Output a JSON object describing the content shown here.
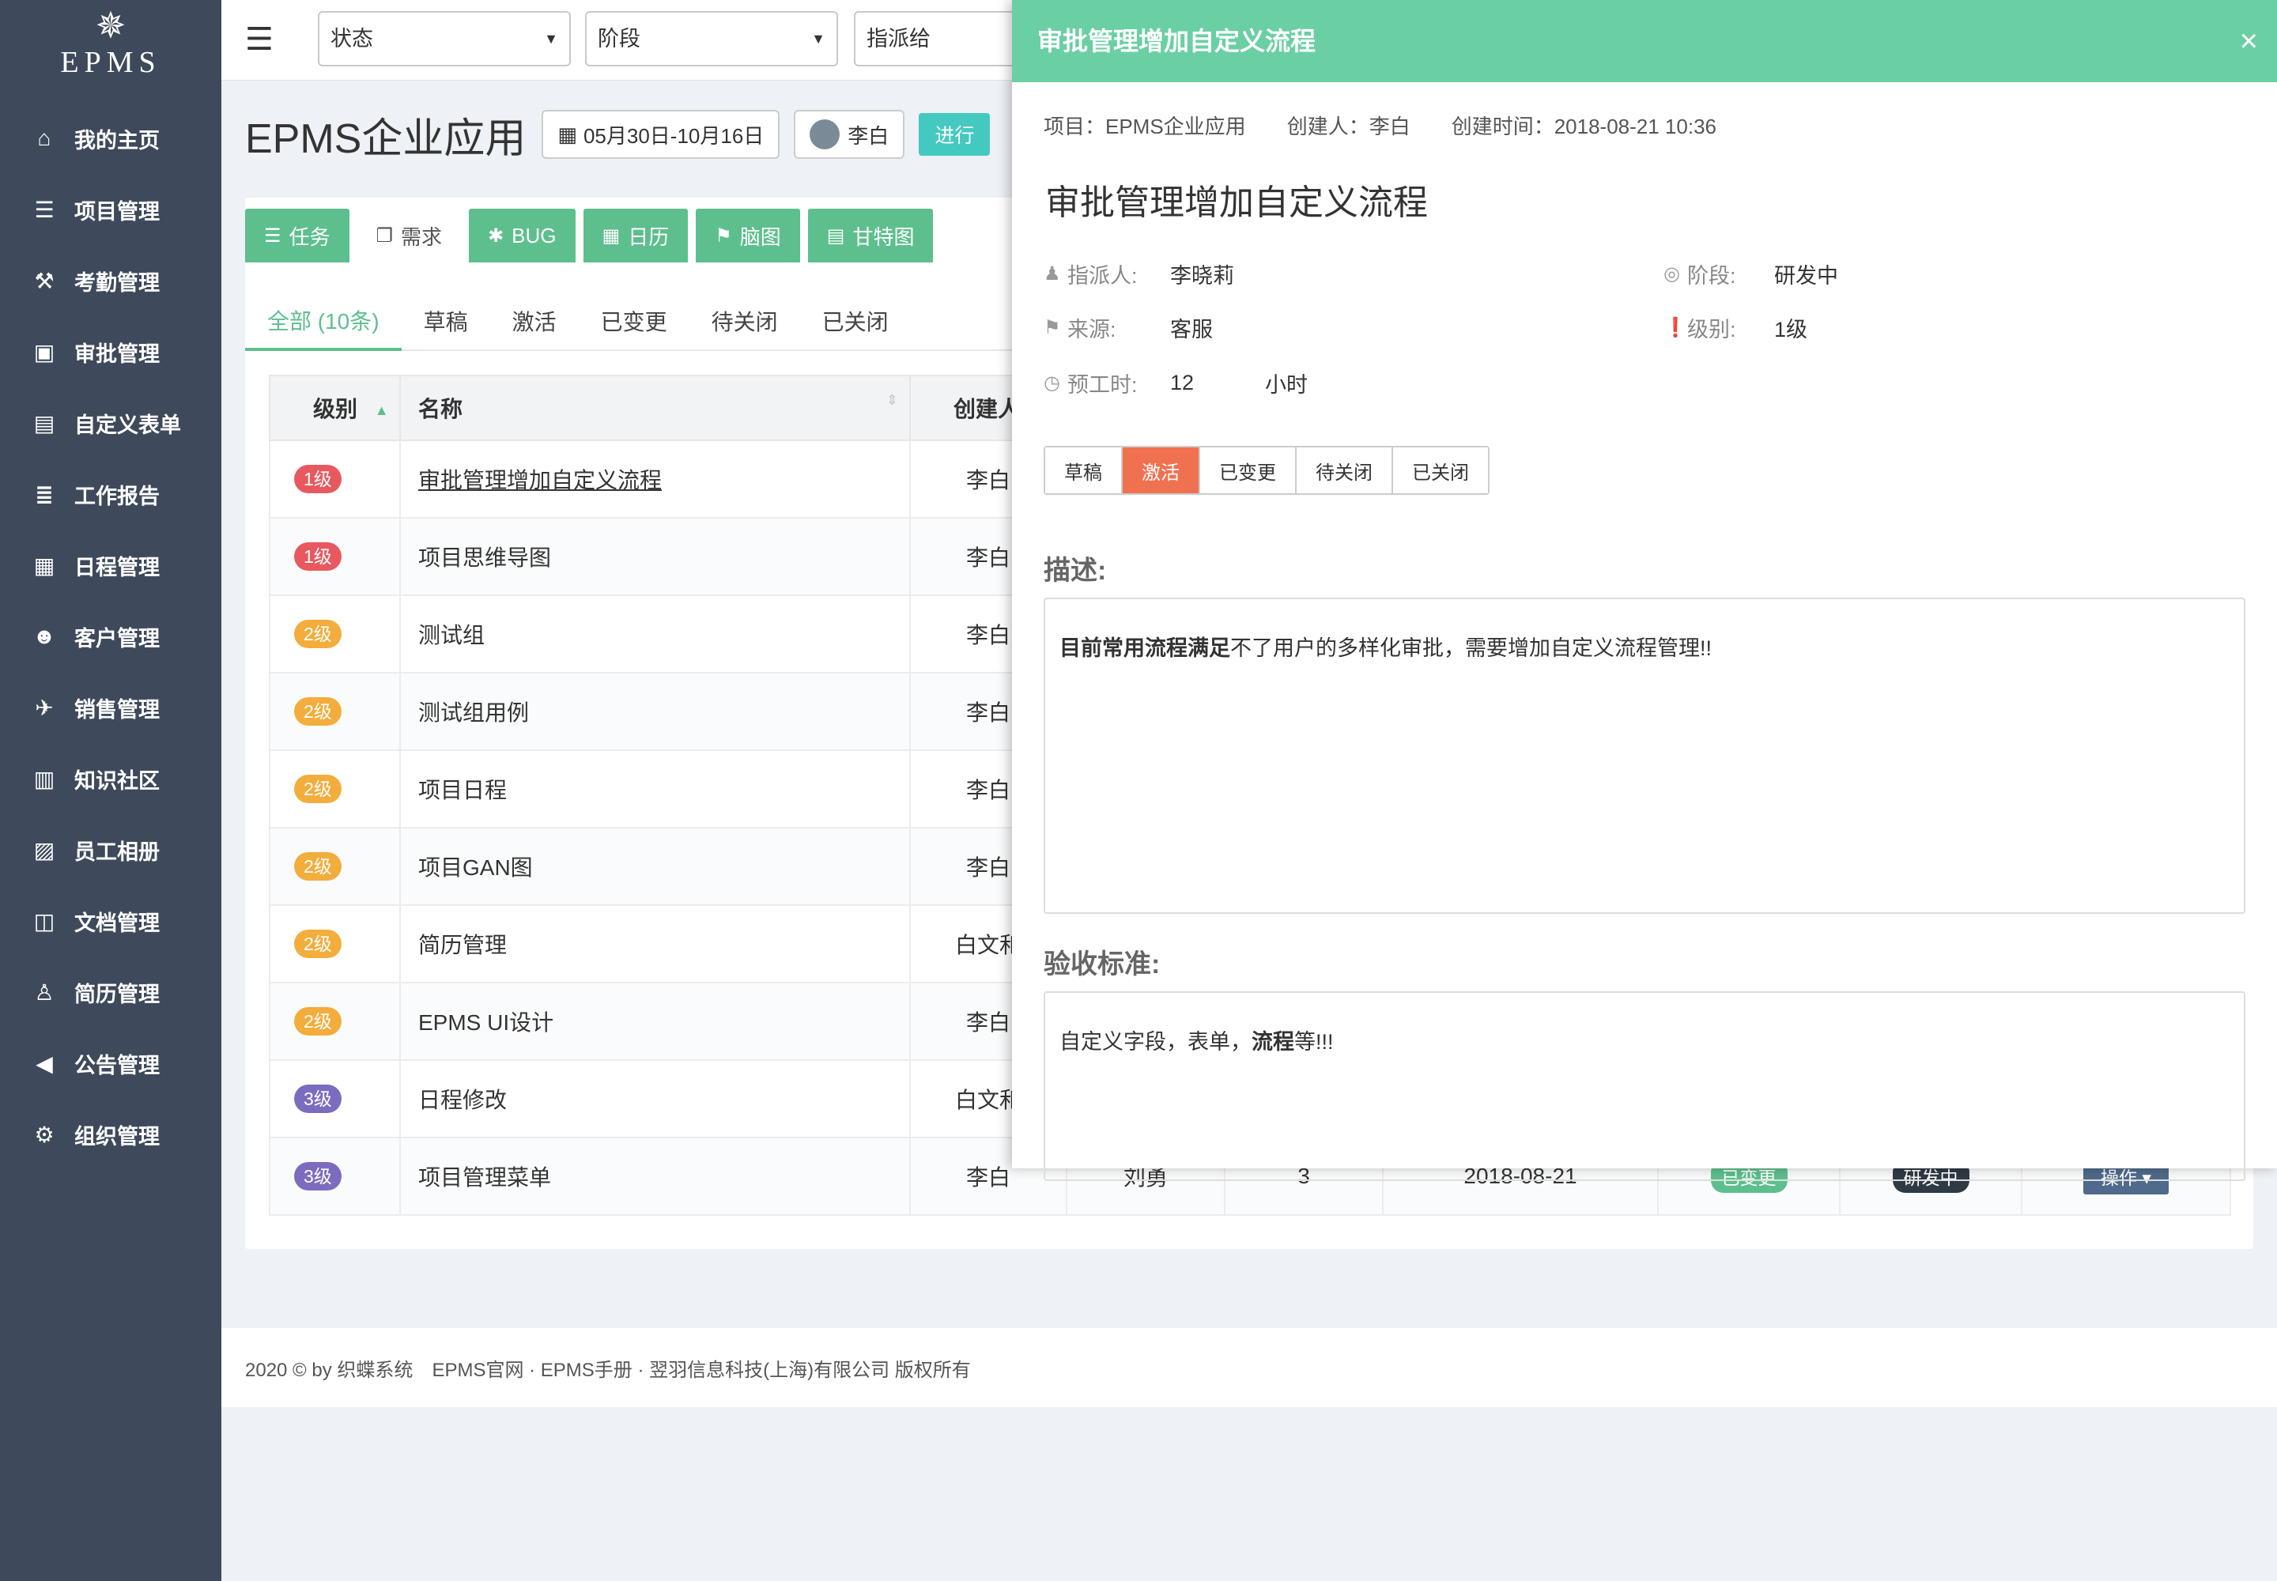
{
  "sidebar": {
    "logo_text": "EPMS",
    "items": [
      {
        "label": "我的主页",
        "icon": "home-icon",
        "glyph": "⌂"
      },
      {
        "label": "项目管理",
        "icon": "list-icon",
        "glyph": "☰"
      },
      {
        "label": "考勤管理",
        "icon": "gavel-icon",
        "glyph": "⚒"
      },
      {
        "label": "审批管理",
        "icon": "briefcase-icon",
        "glyph": "▣"
      },
      {
        "label": "自定义表单",
        "icon": "form-icon",
        "glyph": "▤"
      },
      {
        "label": "工作报告",
        "icon": "report-icon",
        "glyph": "≣"
      },
      {
        "label": "日程管理",
        "icon": "calendar-icon",
        "glyph": "▦"
      },
      {
        "label": "客户管理",
        "icon": "users-icon",
        "glyph": "☻"
      },
      {
        "label": "销售管理",
        "icon": "plane-icon",
        "glyph": "✈"
      },
      {
        "label": "知识社区",
        "icon": "book-icon",
        "glyph": "▥"
      },
      {
        "label": "员工相册",
        "icon": "image-icon",
        "glyph": "▨"
      },
      {
        "label": "文档管理",
        "icon": "columns-icon",
        "glyph": "◫"
      },
      {
        "label": "简历管理",
        "icon": "person-icon",
        "glyph": "♙"
      },
      {
        "label": "公告管理",
        "icon": "bullhorn-icon",
        "glyph": "◀"
      },
      {
        "label": "组织管理",
        "icon": "cogs-icon",
        "glyph": "⚙"
      }
    ]
  },
  "topbar": {
    "status_select": "状态",
    "stage_select": "阶段",
    "assignee_select": "指派给"
  },
  "project": {
    "name": "EPMS企业应用",
    "date_range": "05月30日-10月16日",
    "owner": "李白",
    "status": "进行"
  },
  "module_tabs": [
    {
      "label": "任务",
      "glyph": "☰"
    },
    {
      "label": "需求",
      "glyph": "❐"
    },
    {
      "label": "BUG",
      "glyph": "✱"
    },
    {
      "label": "日历",
      "glyph": "▦"
    },
    {
      "label": "脑图",
      "glyph": "⚑"
    },
    {
      "label": "甘特图",
      "glyph": "▤"
    }
  ],
  "filter_tabs": [
    "全部 (10条)",
    "草稿",
    "激活",
    "已变更",
    "待关闭",
    "已关闭"
  ],
  "table": {
    "headers": {
      "level": "级别",
      "name": "名称",
      "creator": "创建人"
    },
    "rows": [
      {
        "level": "1级",
        "name": "审批管理增加自定义流程",
        "creator": "李白"
      },
      {
        "level": "1级",
        "name": "项目思维导图",
        "creator": "李白"
      },
      {
        "level": "2级",
        "name": "测试组",
        "creator": "李白"
      },
      {
        "level": "2级",
        "name": "测试组用例",
        "creator": "李白"
      },
      {
        "level": "2级",
        "name": "项目日程",
        "creator": "李白"
      },
      {
        "level": "2级",
        "name": "项目GAN图",
        "creator": "李白"
      },
      {
        "level": "2级",
        "name": "简历管理",
        "creator": "白文和"
      },
      {
        "level": "2级",
        "name": "EPMS UI设计",
        "creator": "李白"
      },
      {
        "level": "3级",
        "name": "日程修改",
        "creator": "白文和"
      },
      {
        "level": "3级",
        "name": "项目管理菜单",
        "creator": "李白",
        "assignee": "刘勇",
        "hours": "3",
        "date": "2018-08-21",
        "status": "已变更",
        "stage": "研发中",
        "action": "操作 ▾"
      }
    ],
    "level_colors": {
      "1级": "#e8595f",
      "2级": "#f3ad3c",
      "3级": "#7c6cbf"
    }
  },
  "footer": {
    "copyright": "2020 © by 织蝶系统",
    "links": "EPMS官网 · EPMS手册 · 翌羽信息科技(上海)有限公司 版权所有"
  },
  "drawer": {
    "title": "审批管理增加自定义流程",
    "close": "×",
    "meta": {
      "project": "项目：EPMS企业应用",
      "creator": "创建人：李白",
      "created_at": "创建时间：2018-08-21 10:36"
    },
    "heading": "审批管理增加自定义流程",
    "fields": {
      "assignee_label": "指派人:",
      "assignee": "李晓莉",
      "stage_label": "阶段:",
      "stage": "研发中",
      "source_label": "来源:",
      "source": "客服",
      "level_label": "级别:",
      "level": "1级",
      "hours_label": "预工时:",
      "hours": "12",
      "hours_unit": "小时"
    },
    "status_buttons": [
      "草稿",
      "激活",
      "已变更",
      "待关闭",
      "已关闭"
    ],
    "active_status": "激活",
    "description_label": "描述:",
    "description_bold": "目前常用流程满足",
    "description_rest": "不了用户的多样化审批，需要增加自定义流程管理!!",
    "acceptance_label": "验收标准:",
    "acceptance_part1": "自定义字段，表单，",
    "acceptance_bold": "流程",
    "acceptance_part2": "等!!!"
  }
}
